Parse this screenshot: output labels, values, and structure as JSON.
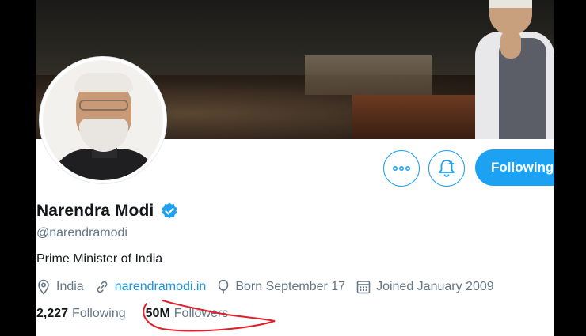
{
  "profile": {
    "name": "Narendra Modi",
    "handle": "@narendramodi",
    "bio": "Prime Minister of India",
    "location": "India",
    "website": "narendramodi.in",
    "birthday": "Born September 17",
    "joined": "Joined January 2009",
    "verified": true
  },
  "actions": {
    "more_icon": "more-icon",
    "bell_icon": "notification-bell-icon",
    "follow_label": "Following"
  },
  "stats": {
    "following_count": "2,227",
    "following_label": "Following",
    "followers_count": "50M",
    "followers_label": "Followers"
  },
  "colors": {
    "accent": "#1da1f2",
    "link": "#1b95e0",
    "secondary_text": "#657786",
    "annotation": "#e0202a"
  }
}
